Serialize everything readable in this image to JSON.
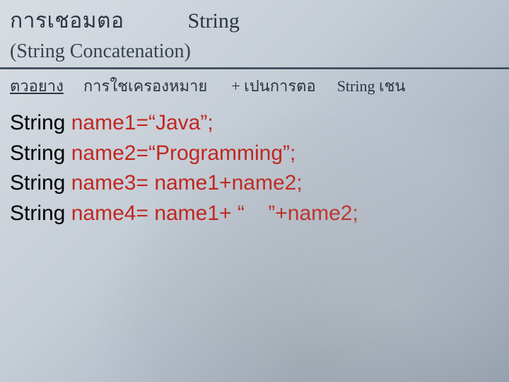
{
  "header": {
    "title_thai": "การเชอมตอ",
    "title_string": "String",
    "subtitle": "(String Concatenation)"
  },
  "example_row": {
    "label": "ตวอยาง",
    "mid": "การใชเครองหมาย",
    "plus": "+ เปนการตอ",
    "tail": "String เชน"
  },
  "code": {
    "l1": {
      "kw": "String ",
      "var": "name1",
      "op": "=",
      "str": "“Java”",
      "end": ";"
    },
    "l2": {
      "kw": "String ",
      "var": "name2",
      "op": "=",
      "str": "“Programming”",
      "end": ";"
    },
    "l3": {
      "kw": "String ",
      "var": "name3",
      "op": "= ",
      "rhs_a": "name1",
      "plus": "+",
      "rhs_b": "name2",
      "end": ";"
    },
    "l4": {
      "kw": "String ",
      "var": "name4",
      "op": "= ",
      "rhs_a": "name1",
      "plus1": "+ ",
      "str": "“    ”",
      "plus2": "+",
      "rhs_b": "name2",
      "end": ";"
    }
  }
}
